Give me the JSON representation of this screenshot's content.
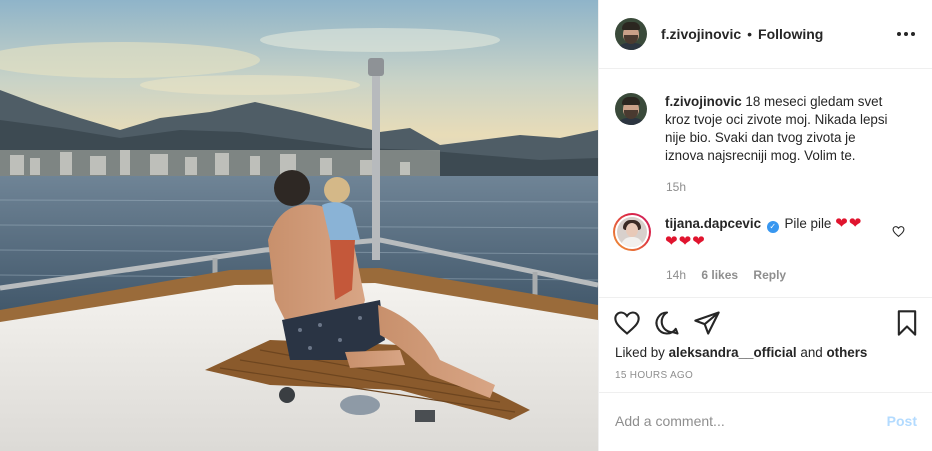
{
  "post": {
    "author": "f.zivojinovic",
    "separator": "•",
    "follow_status": "Following",
    "caption": "18 meseci gledam svet kroz tvoje oci zivote moj. Nikada lepsi nije bio. Svaki dan tvog zivota je iznova najsrecniji mog. Volim te.",
    "caption_time": "15h"
  },
  "comment": {
    "author": "tijana.dapcevic",
    "text": "Pile pile",
    "hearts_line1": "❤❤",
    "hearts_line2": "❤❤❤",
    "time": "14h",
    "likes": "6 likes",
    "reply": "Reply"
  },
  "likes": {
    "prefix": "Liked by",
    "user": "aleksandra__official",
    "and": "and",
    "others": "others"
  },
  "timestamp": "15 HOURS AGO",
  "add_comment": {
    "placeholder": "Add a comment...",
    "post_label": "Post"
  },
  "icons": {
    "like": "heart-icon",
    "comment": "comment-icon",
    "share": "share-icon",
    "save": "bookmark-icon",
    "more": "more-options-icon",
    "comment_like": "small-heart-icon"
  },
  "colors": {
    "text": "#262626",
    "muted": "#8e8e8e",
    "verified": "#3897f0",
    "post_disabled": "#b3dbff",
    "heart": "#e0142e"
  }
}
